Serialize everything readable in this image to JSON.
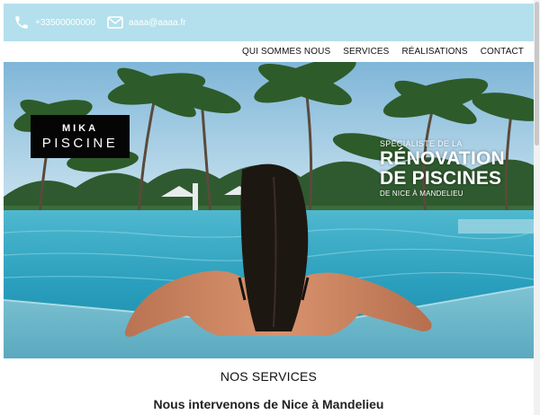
{
  "topbar": {
    "phone": "+33500000000",
    "email": "aaaa@aaaa.fr",
    "phone_icon": "phone-icon",
    "email_icon": "envelope-icon",
    "background": "#b3e0ec"
  },
  "nav": {
    "items": [
      {
        "label": "QUI SOMMES NOUS"
      },
      {
        "label": "SERVICES"
      },
      {
        "label": "RÉALISATIONS"
      },
      {
        "label": "CONTACT"
      }
    ]
  },
  "hero": {
    "logo_line1": "MIKA",
    "logo_line2": "PISCINE",
    "tagline_small": "SPÉCIALISTE DE LA",
    "tagline_big_1": "RÉNOVATION",
    "tagline_big_2": "DE PISCINES",
    "tagline_sub": "DE NICE À MANDELIEU"
  },
  "services": {
    "title": "NOS SERVICES",
    "subtitle": "Nous intervenons de Nice à Mandelieu"
  }
}
